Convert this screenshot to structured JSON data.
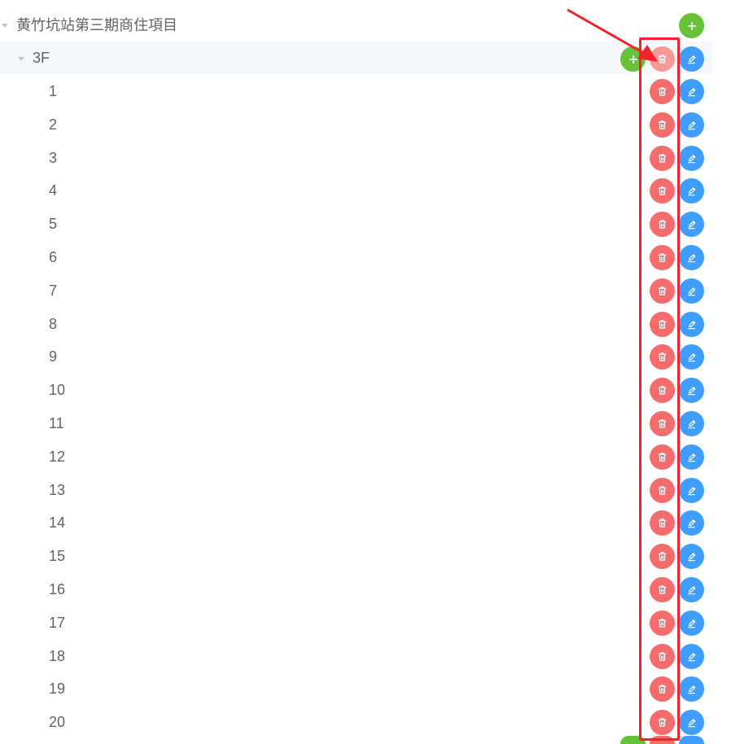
{
  "tree": {
    "root": {
      "label": "黄竹坑站第三期商住項目"
    },
    "floor": {
      "label": "3F"
    },
    "units": [
      "1",
      "2",
      "3",
      "4",
      "5",
      "6",
      "7",
      "8",
      "9",
      "10",
      "11",
      "12",
      "13",
      "14",
      "15",
      "16",
      "17",
      "18",
      "19",
      "20"
    ]
  },
  "icons": {
    "add": "plus-icon",
    "delete": "trash-icon",
    "edit": "edit-icon",
    "expand": "caret-down-icon"
  },
  "colors": {
    "add": "#67c23a",
    "delete": "#f56c6c",
    "delete_hover": "#f89898",
    "edit": "#409eff",
    "annotation": "#f5222d",
    "row_hover": "#f5f7fa",
    "text": "#606266"
  }
}
